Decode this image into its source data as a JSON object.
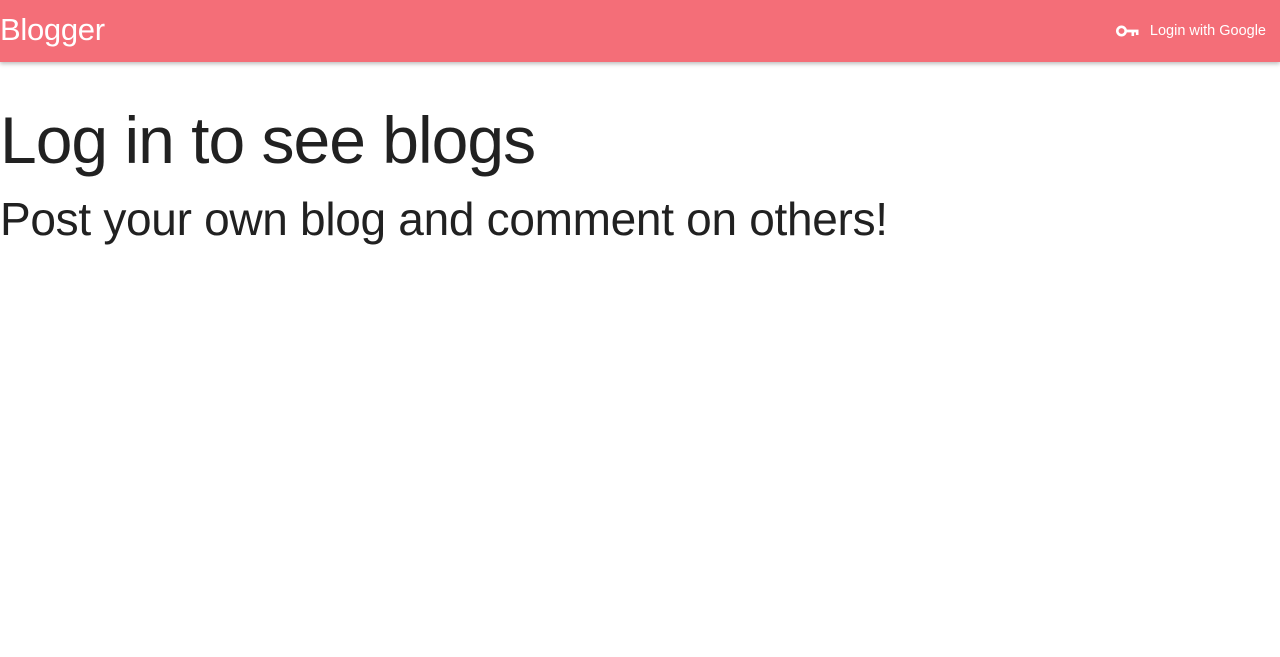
{
  "navbar": {
    "brand": "Blogger",
    "login": {
      "icon": "key-icon",
      "label": "Login with Google"
    }
  },
  "main": {
    "headline": "Log in to see blogs",
    "subheadline": "Post your own blog and comment on others!"
  },
  "colors": {
    "navbar_background": "#f46e78",
    "navbar_text": "#ffffff",
    "body_text": "#212121",
    "page_background": "#ffffff"
  }
}
